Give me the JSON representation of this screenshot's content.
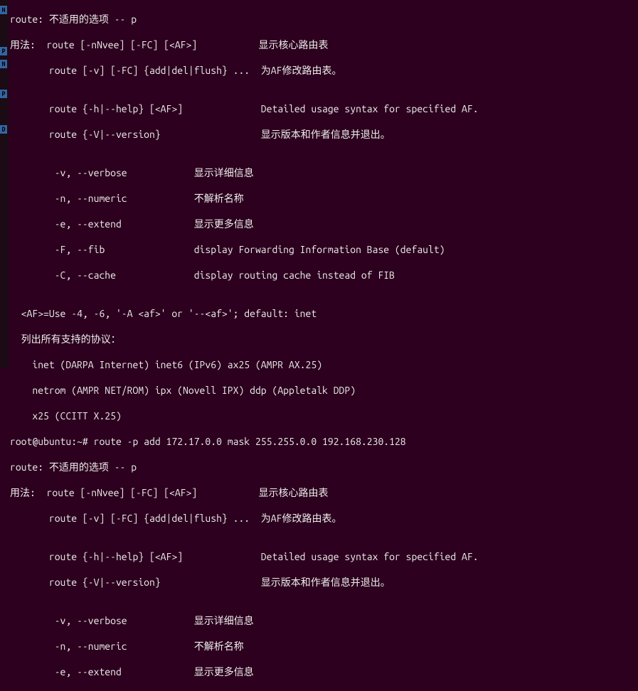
{
  "sidebar": {
    "badges": [
      "N",
      "P",
      "N",
      "P",
      "D"
    ]
  },
  "term": {
    "lines": [
      "route: 不适用的选项 -- p",
      "用法:  route [-nNvee] [-FC] [<AF>]           显示核心路由表",
      "       route [-v] [-FC] {add|del|flush} ...  为AF修改路由表。",
      "",
      "       route {-h|--help} [<AF>]              Detailed usage syntax for specified AF.",
      "       route {-V|--version}                  显示版本和作者信息并退出。",
      "",
      "        -v, --verbose            显示详细信息",
      "        -n, --numeric            不解析名称",
      "        -e, --extend             显示更多信息",
      "        -F, --fib                display Forwarding Information Base (default)",
      "        -C, --cache              display routing cache instead of FIB",
      "",
      "  <AF>=Use -4, -6, '-A <af>' or '--<af>'; default: inet",
      "  列出所有支持的协议：",
      "    inet (DARPA Internet) inet6 (IPv6) ax25 (AMPR AX.25) ",
      "    netrom (AMPR NET/ROM) ipx (Novell IPX) ddp (Appletalk DDP) ",
      "    x25 (CCITT X.25) ",
      "root@ubuntu:~# route -p add 172.17.0.0 mask 255.255.0.0 192.168.230.128",
      "route: 不适用的选项 -- p",
      "用法:  route [-nNvee] [-FC] [<AF>]           显示核心路由表",
      "       route [-v] [-FC] {add|del|flush} ...  为AF修改路由表。",
      "",
      "       route {-h|--help} [<AF>]              Detailed usage syntax for specified AF.",
      "       route {-V|--version}                  显示版本和作者信息并退出。",
      "",
      "        -v, --verbose            显示详细信息",
      "        -n, --numeric            不解析名称",
      "        -e, --extend             显示更多信息"
    ]
  }
}
